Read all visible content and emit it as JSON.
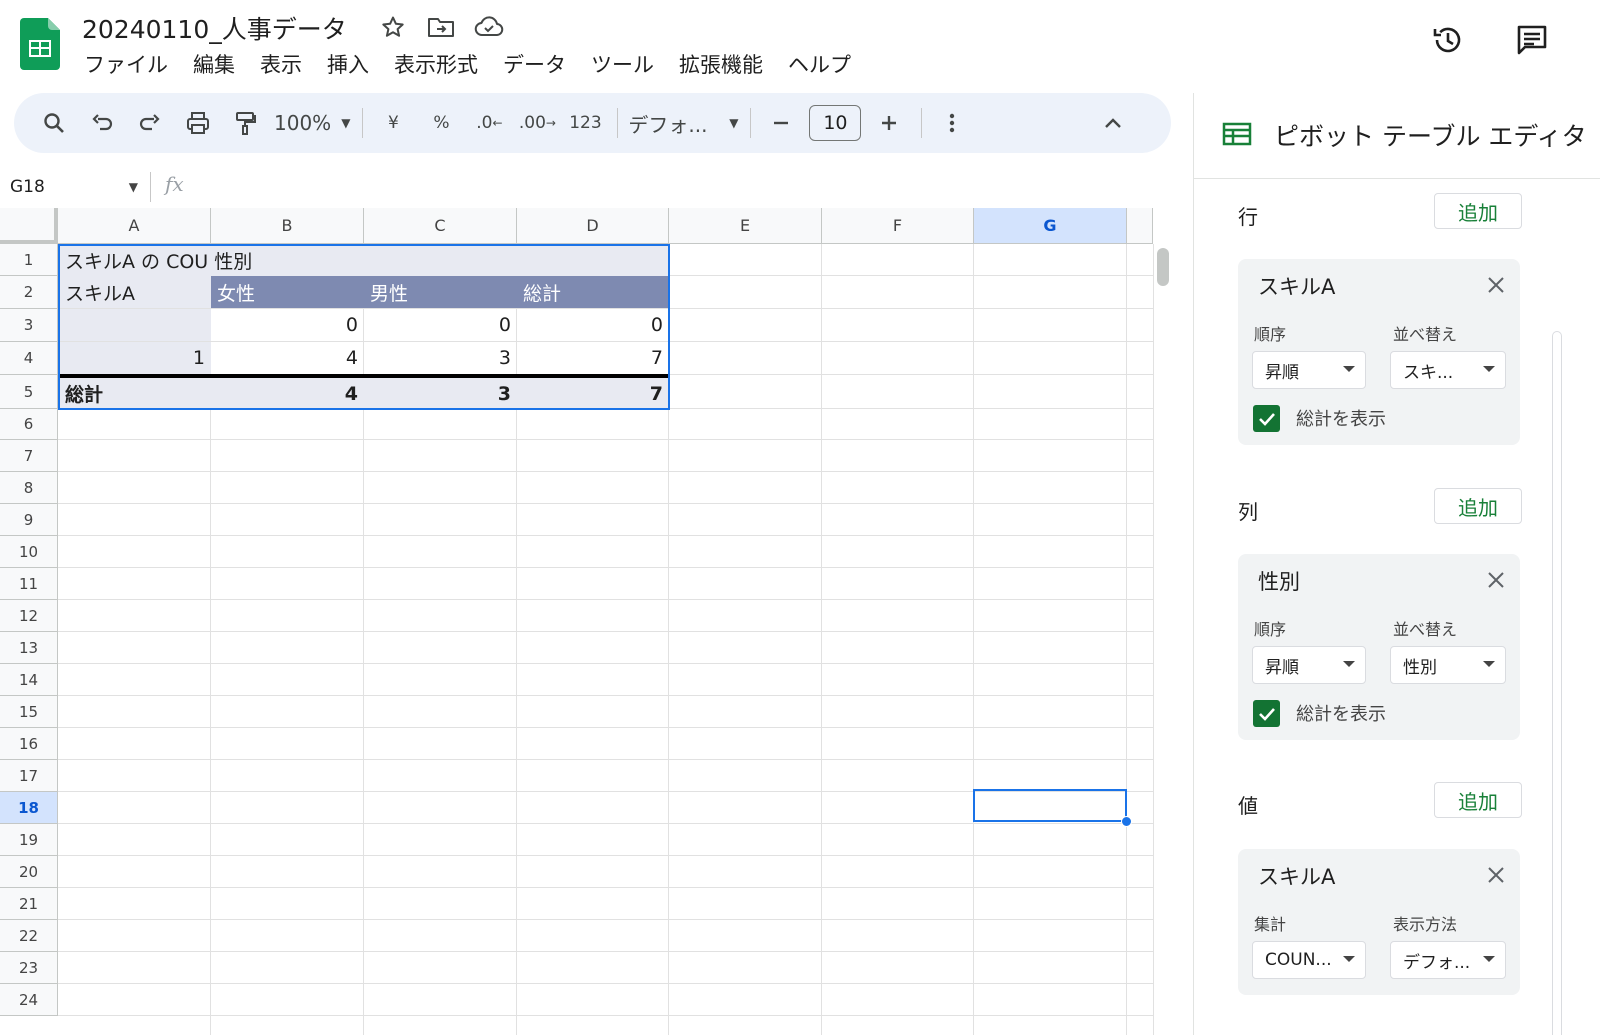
{
  "doc": {
    "title": "20240110_人事データ"
  },
  "menu": [
    "ファイル",
    "編集",
    "表示",
    "挿入",
    "表示形式",
    "データ",
    "ツール",
    "拡張機能",
    "ヘルプ"
  ],
  "toolbar": {
    "zoom": "100%",
    "currency": "¥",
    "percent": "%",
    "dec_decrease": ".0",
    "dec_increase": ".00",
    "number_format": "123",
    "font": "デフォ...",
    "font_size": "10"
  },
  "formula_bar": {
    "cell_ref": "G18",
    "fx": "fx"
  },
  "columns": [
    "A",
    "B",
    "C",
    "D",
    "E",
    "F",
    "G"
  ],
  "selected_column": "G",
  "rows": [
    "1",
    "2",
    "3",
    "4",
    "5",
    "6",
    "7",
    "8",
    "9",
    "10",
    "11",
    "12",
    "13",
    "14",
    "15",
    "16",
    "17",
    "18",
    "19",
    "20",
    "21",
    "22",
    "23",
    "24"
  ],
  "selected_row": "18",
  "pivot": {
    "title": "スキルA の COU 性別",
    "row_header": "スキルA",
    "col_headers": [
      "女性",
      "男性",
      "総計"
    ],
    "data_rows": [
      {
        "label": "",
        "values": [
          "0",
          "0",
          "0"
        ]
      },
      {
        "label": "1",
        "values": [
          "4",
          "3",
          "7"
        ]
      }
    ],
    "total": {
      "label": "総計",
      "values": [
        "4",
        "3",
        "7"
      ]
    }
  },
  "editor": {
    "title": "ピボット テーブル エディタ",
    "add_label": "追加",
    "rows_section": {
      "label": "行",
      "card": {
        "field": "スキルA",
        "order_label": "順序",
        "order_value": "昇順",
        "sort_label": "並べ替え",
        "sort_value": "スキ...",
        "show_total_label": "総計を表示",
        "show_total": true
      }
    },
    "cols_section": {
      "label": "列",
      "card": {
        "field": "性別",
        "order_label": "順序",
        "order_value": "昇順",
        "sort_label": "並べ替え",
        "sort_value": "性別",
        "show_total_label": "総計を表示",
        "show_total": true
      }
    },
    "values_section": {
      "label": "値",
      "card": {
        "field": "スキルA",
        "agg_label": "集計",
        "agg_value": "COUN...",
        "display_label": "表示方法",
        "display_value": "デフォ..."
      }
    }
  },
  "icons": [
    "sheets-logo",
    "star-icon",
    "move-folder-icon",
    "cloud-icon",
    "history-icon",
    "comment-icon",
    "search-icon",
    "undo-icon",
    "redo-icon",
    "print-icon",
    "paint-format-icon",
    "minus-icon",
    "plus-icon",
    "more-vert-icon",
    "chevron-up-icon",
    "pivot-table-icon",
    "close-icon",
    "check-icon"
  ],
  "colors": {
    "accent": "#1a73e8",
    "toolbar_bg": "#edf2fa",
    "pivot_header": "#7e8ab1",
    "pivot_light": "#e8eaf2",
    "check": "#137333",
    "add_text": "#188038"
  }
}
